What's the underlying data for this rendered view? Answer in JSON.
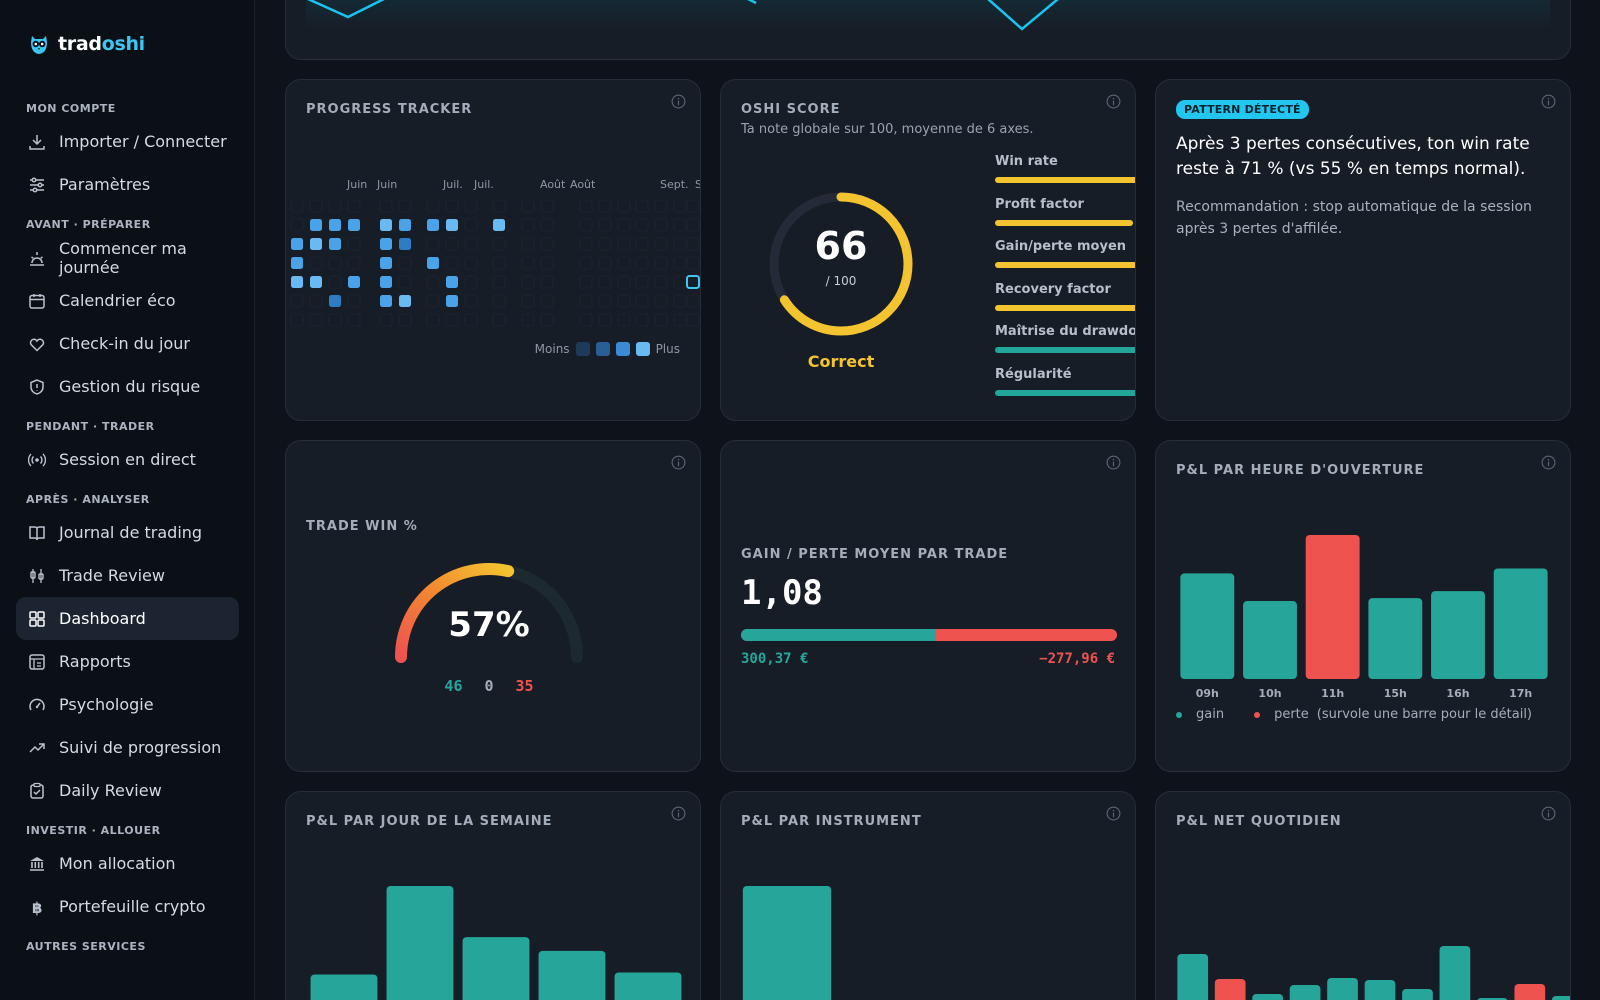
{
  "brand": {
    "name_part1": "trad",
    "name_part2": "oshi"
  },
  "sidebar": {
    "sections": [
      {
        "title": "MON COMPTE",
        "items": [
          {
            "label": "Importer / Connecter",
            "icon": "download-icon"
          },
          {
            "label": "Paramètres",
            "icon": "sliders-icon"
          }
        ]
      },
      {
        "title": "AVANT · PRÉPARER",
        "items": [
          {
            "label": "Commencer ma journée",
            "icon": "sunrise-icon"
          },
          {
            "label": "Calendrier éco",
            "icon": "calendar-icon"
          },
          {
            "label": "Check-in du jour",
            "icon": "heart-icon"
          },
          {
            "label": "Gestion du risque",
            "icon": "shield-icon"
          }
        ]
      },
      {
        "title": "PENDANT · TRADER",
        "items": [
          {
            "label": "Session en direct",
            "icon": "broadcast-icon"
          }
        ]
      },
      {
        "title": "APRÈS · ANALYSER",
        "items": [
          {
            "label": "Journal de trading",
            "icon": "book-icon"
          },
          {
            "label": "Trade Review",
            "icon": "candlestick-icon"
          },
          {
            "label": "Dashboard",
            "icon": "dashboard-icon",
            "active": true
          },
          {
            "label": "Rapports",
            "icon": "report-icon"
          },
          {
            "label": "Psychologie",
            "icon": "gauge-icon"
          },
          {
            "label": "Suivi de progression",
            "icon": "trend-up-icon"
          },
          {
            "label": "Daily Review",
            "icon": "clipboard-check-icon"
          }
        ]
      },
      {
        "title": "INVESTIR · ALLOUER",
        "items": [
          {
            "label": "Mon allocation",
            "icon": "bank-icon"
          },
          {
            "label": "Portefeuille crypto",
            "icon": "bitcoin-icon"
          }
        ]
      },
      {
        "title": "AUTRES SERVICES",
        "items": []
      }
    ]
  },
  "progress": {
    "title": "PROGRESS TRACKER",
    "months": [
      "Juin",
      "Juin",
      "Juil.",
      "Juil.",
      "Août",
      "Août",
      "Sept.",
      "S"
    ],
    "legend_less": "Moins",
    "legend_more": "Plus",
    "colors": {
      "empty": "#1b2230",
      "l1": "#1d4f7d",
      "l2": "#2e7cc4",
      "l3": "#4aa3e8",
      "l4": "#69b9f2",
      "today": "#3ec6f2"
    }
  },
  "oshi": {
    "title": "OSHI SCORE",
    "subtitle": "Ta note globale sur 100, moyenne de 6 axes.",
    "score": 66,
    "score_max": "/ 100",
    "grade": "Correct",
    "axes": [
      {
        "name": "Win rate",
        "level": 1.0,
        "color": "#f4c430"
      },
      {
        "name": "Profit factor",
        "level": 0.97,
        "color": "#f4c430"
      },
      {
        "name": "Gain/perte moyen",
        "level": 1.0,
        "color": "#f4c430"
      },
      {
        "name": "Recovery factor",
        "level": 1.0,
        "color": "#f4c430"
      },
      {
        "name": "Maîtrise du drawdown",
        "level": 1.0,
        "color": "#22a699"
      },
      {
        "name": "Régularité",
        "level": 1.0,
        "color": "#22a699"
      }
    ]
  },
  "pattern": {
    "badge": "PATTERN DÉTECTÉ",
    "headline": "Après 3 pertes consécutives, ton win rate reste à 71 % (vs 55 % en temps normal).",
    "recommendation": "Recommandation : stop automatique de la session après 3 pertes d'affilée."
  },
  "winrate": {
    "title": "TRADE WIN %",
    "value": "57%",
    "fraction": 0.57,
    "wins": "46",
    "breakeven": "0",
    "losses": "35"
  },
  "avgtrade": {
    "title": "GAIN / PERTE MOYEN PAR TRADE",
    "ratio": "1,08",
    "avg_gain": "300,37 €",
    "avg_loss": "−277,96 €",
    "gain_share": 0.519
  },
  "colors": {
    "gain": "#26a69a",
    "loss": "#ef5350",
    "accent": "#3ec6f2"
  },
  "chart_data": [
    {
      "type": "bar",
      "title": "P&L PAR HEURE D'OUVERTURE",
      "categories": [
        "09h",
        "10h",
        "11h",
        "15h",
        "16h",
        "17h"
      ],
      "values": [
        107,
        79,
        146,
        82,
        89,
        112
      ],
      "signs": [
        "gain",
        "gain",
        "perte",
        "gain",
        "gain",
        "gain"
      ],
      "ylim": [
        0,
        150
      ],
      "legend": {
        "gain": "gain",
        "loss": "perte",
        "hint": "(survole une barre pour le détail)"
      }
    },
    {
      "type": "bar",
      "title": "P&L PAR JOUR DE LA SEMAINE",
      "categories": [
        "",
        "",
        "",
        "",
        ""
      ],
      "values": [
        28,
        118,
        66,
        52,
        30
      ],
      "ylim": [
        0,
        120
      ]
    },
    {
      "type": "bar",
      "title": "P&L PAR INSTRUMENT",
      "categories": [
        "",
        ""
      ],
      "values": [
        118,
        2
      ],
      "ylim": [
        0,
        120
      ]
    },
    {
      "type": "bar",
      "title": "P&L NET QUOTIDIEN",
      "categories": [
        "",
        "",
        "",
        "",
        "",
        "",
        "",
        "",
        "",
        "",
        ""
      ],
      "values": [
        48,
        -23,
        8,
        17,
        24,
        22,
        13,
        56,
        4,
        -18,
        6
      ],
      "ylim": [
        0,
        60
      ]
    }
  ]
}
